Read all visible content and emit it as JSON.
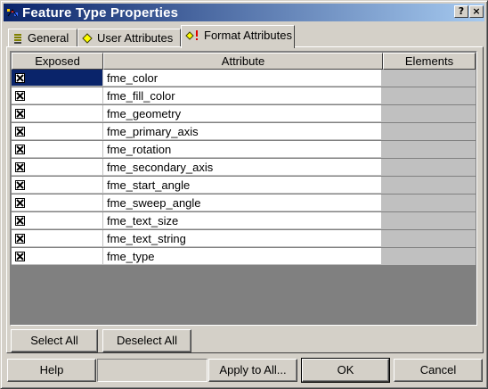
{
  "window": {
    "title": "Feature Type Properties",
    "help_glyph": "?",
    "close_glyph": "×"
  },
  "tabs": [
    {
      "label": "General",
      "icon": "list-icon",
      "active": false
    },
    {
      "label": "User Attributes",
      "icon": "diamond-icon",
      "active": false
    },
    {
      "label": "Format Attributes",
      "icon": "diamond-alert-icon",
      "active": true
    }
  ],
  "table": {
    "columns": [
      "Exposed",
      "Attribute",
      "Elements"
    ],
    "rows": [
      {
        "exposed": true,
        "attribute": "fme_color",
        "elements": ""
      },
      {
        "exposed": true,
        "attribute": "fme_fill_color",
        "elements": ""
      },
      {
        "exposed": true,
        "attribute": "fme_geometry",
        "elements": ""
      },
      {
        "exposed": true,
        "attribute": "fme_primary_axis",
        "elements": ""
      },
      {
        "exposed": true,
        "attribute": "fme_rotation",
        "elements": ""
      },
      {
        "exposed": true,
        "attribute": "fme_secondary_axis",
        "elements": ""
      },
      {
        "exposed": true,
        "attribute": "fme_start_angle",
        "elements": ""
      },
      {
        "exposed": true,
        "attribute": "fme_sweep_angle",
        "elements": ""
      },
      {
        "exposed": true,
        "attribute": "fme_text_size",
        "elements": ""
      },
      {
        "exposed": true,
        "attribute": "fme_text_string",
        "elements": ""
      },
      {
        "exposed": true,
        "attribute": "fme_type",
        "elements": ""
      }
    ],
    "selected_row": 0
  },
  "panel_buttons": {
    "select_all": "Select All",
    "deselect_all": "Deselect All"
  },
  "dialog_buttons": {
    "help": "Help",
    "apply_to_all": "Apply to All...",
    "ok": "OK",
    "cancel": "Cancel"
  },
  "colors": {
    "title_start": "#0a246a",
    "title_end": "#a6caf0",
    "face": "#d4d0c8",
    "selection": "#0a246a"
  }
}
